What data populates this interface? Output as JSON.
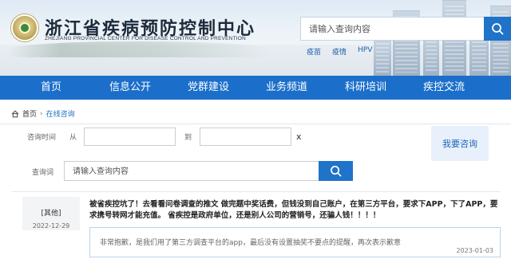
{
  "header": {
    "org_name_cn": "浙江省疾病预防控制中心",
    "org_name_en": "ZHEJIANG PROVINCIAL CENTER FOR DISEASE CONTROL AND PREVENTION",
    "search": {
      "placeholder": "请输入查询内容"
    },
    "hot_words": [
      "疫苗",
      "疫情",
      "HPV"
    ]
  },
  "nav": {
    "items": [
      {
        "label": "首页"
      },
      {
        "label": "信息公开"
      },
      {
        "label": "党群建设"
      },
      {
        "label": "业务频道"
      },
      {
        "label": "科研培训"
      },
      {
        "label": "疾控交流"
      }
    ]
  },
  "breadcrumb": {
    "home": "首页",
    "separator": "›",
    "current": "在线咨询"
  },
  "filter": {
    "time_label": "咨询时间",
    "from_label": "从",
    "to_label": "到",
    "clear_label": "x",
    "keyword_label": "查询词",
    "keyword_placeholder": "请输入查询内容",
    "ask_button": "我要咨询"
  },
  "qa": {
    "category": "[其他]",
    "question_date": "2022-12-29",
    "question": "被省疾控坑了！去看看问卷调查的推文 做完题中奖话费，但钱没到自己账户，在第三方平台，要求下APP，下了APP，要求携号转网才能充值。 省疾控是政府单位，还是别人公司的营销号，还骗人钱！！！！",
    "answer": "非常抱歉，是我们用了第三方调查平台的app，最后没有设置抽奖不要点的提醒，再次表示歉意",
    "answer_date": "2023-01-03"
  },
  "colors": {
    "primary": "#1b6fca",
    "search_button": "#1f73c9",
    "link": "#1f6fc0",
    "answer_border": "#b9d3ef"
  }
}
